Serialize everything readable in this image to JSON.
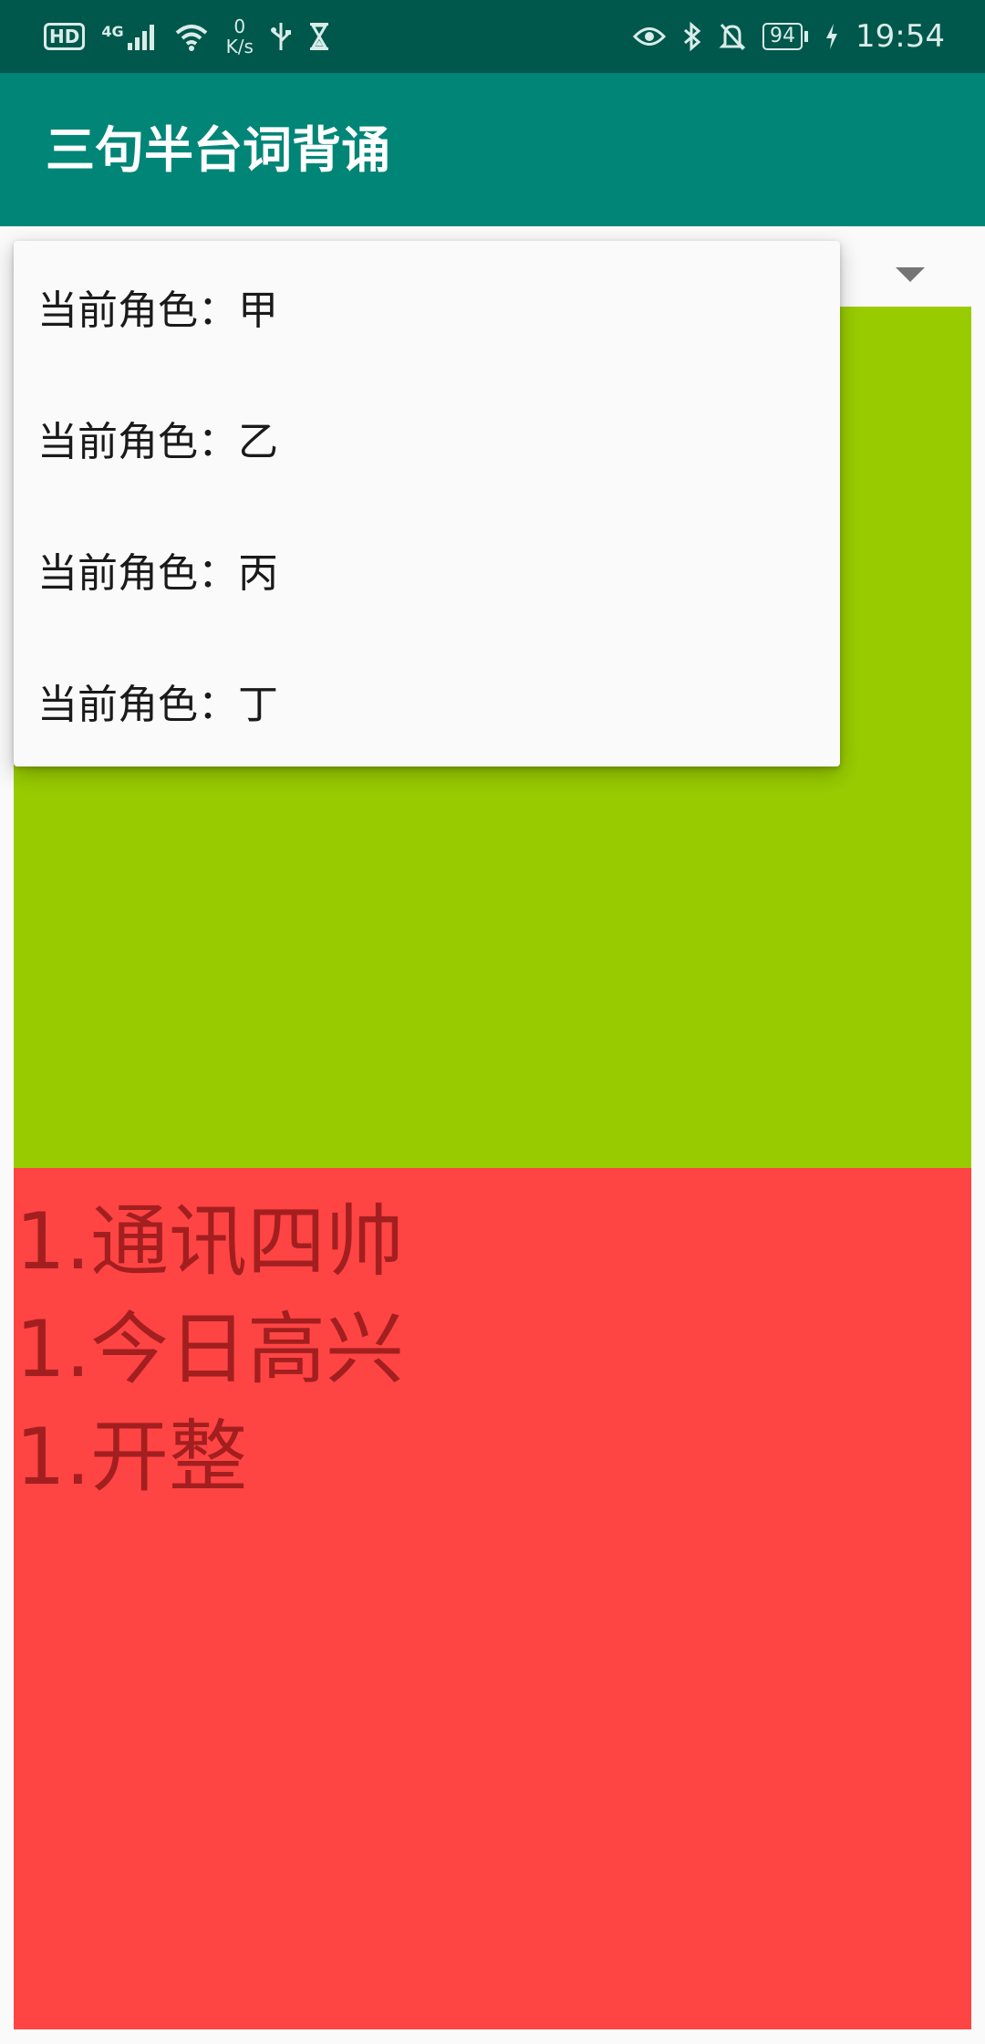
{
  "status_bar": {
    "hd": "HD",
    "network_type": "4G",
    "net_speed_value": "0",
    "net_speed_unit": "K/s",
    "battery_level": "94",
    "time": "19:54",
    "icons": [
      "hd-icon",
      "cellular-signal-icon",
      "wifi-icon",
      "usb-icon",
      "hourglass-icon",
      "eye-icon",
      "bluetooth-icon",
      "notifications-off-icon",
      "battery-icon",
      "charging-icon"
    ]
  },
  "app_bar": {
    "title": "三句半台词背诵"
  },
  "spinner": {
    "options": [
      "当前角色：甲",
      "当前角色：乙",
      "当前角色：丙",
      "当前角色：丁"
    ]
  },
  "lines_panel": {
    "lines": [
      "1.通讯四帅",
      "1.今日高兴",
      "1.开整"
    ]
  },
  "colors": {
    "status_bar": "#00574b",
    "app_bar": "#008577",
    "green_panel": "#99cc00",
    "red_panel": "#ff4444",
    "line_text": "#a31f1f"
  }
}
